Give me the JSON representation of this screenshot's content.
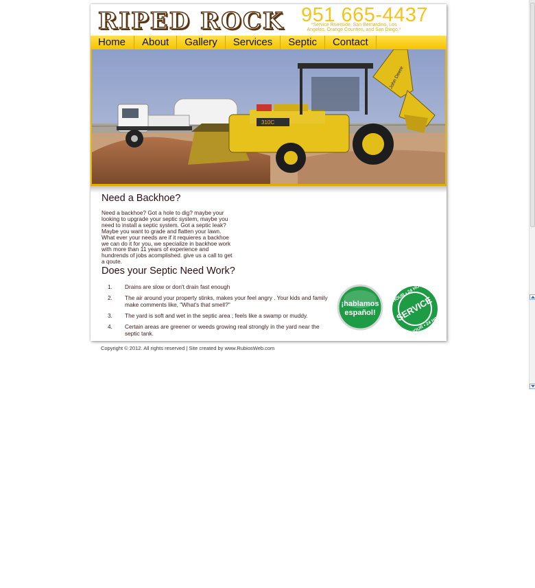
{
  "site": {
    "logo": "RIPED ROCK",
    "phone": "951 665-4437",
    "service_area": "*Service Riverside, San Bernardino, Los Angeles, Orange Counties, and San Diego.*"
  },
  "nav": {
    "items": [
      {
        "label": "Home"
      },
      {
        "label": "About"
      },
      {
        "label": "Gallery"
      },
      {
        "label": "Services"
      },
      {
        "label": "Septic"
      },
      {
        "label": "Contact"
      }
    ]
  },
  "hero": {
    "backhoe_model": "310C",
    "backhoe_brand": "John Deere"
  },
  "content": {
    "heading_backhoe": "Need a Backhoe?",
    "intro": "Need a backhoe? Got a hole to dig? maybe your looking to upgrade your septic system, maybe you need to install a septic system. Got a septic leak? Maybe you want to grade and flatten your lawn. What ever your needs are if it requieres a backhoe we can do it for you, we specialize in backhoe work with more than 11 years of experience and hundrends of jobs acomplished. give us a call to get a qoute.",
    "heading_septic": "Does your Septic Need Work?",
    "steps": [
      {
        "num": "1.",
        "text": "Drains are slow or don't drain fast enough"
      },
      {
        "num": "2.",
        "text": "The air around your property stinks, makes your feel angry . Your kids and family make comments like, \"What's that smell?\""
      },
      {
        "num": "3.",
        "text": "The yard is soft and wet in the septic area ; feels like a swamp or muddy."
      },
      {
        "num": "4.",
        "text": "Certain areas are greener or weeds growing real strongly in the yard near the septic tank."
      }
    ]
  },
  "badges": {
    "spanish_line1": "¡hablamos",
    "spanish_line2": "español!",
    "service_top": "24 HOUR • 24 HOUR",
    "service_main": "SERVICE",
    "service_bottom": "24 HOUR • 24 HOUR"
  },
  "footer": {
    "text": "Copyright © 2012. All rights reserved  |  Site created by www.RubiosWeb.com"
  },
  "colors": {
    "accent_yellow": "#f5c400",
    "phone_yellow": "#f4c31c",
    "badge_green": "#1e9b45",
    "text_brown": "#3a1818"
  }
}
